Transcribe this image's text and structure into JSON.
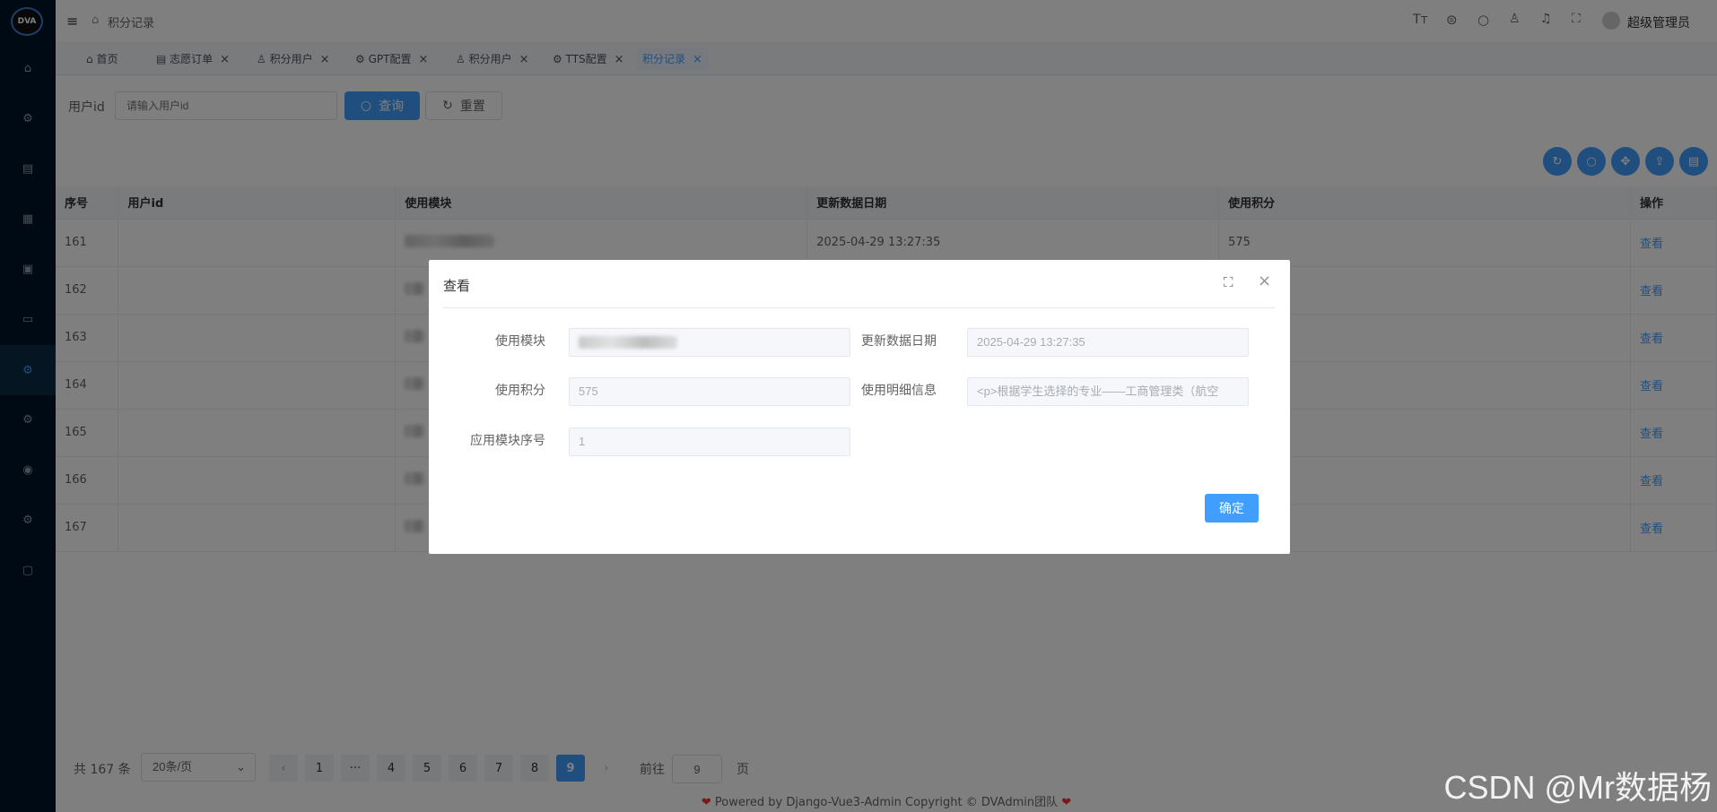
{
  "app": {
    "logo": "DVA",
    "breadcrumb": "积分记录",
    "user_name": "超级管理员"
  },
  "sidebar_icons": [
    "home-icon",
    "settings-icon",
    "document-icon",
    "calendar-icon",
    "report-icon",
    "monitor-icon",
    "gear-icon",
    "gear-icon",
    "user-circle-icon",
    "gear-icon",
    "note-icon"
  ],
  "tabs": [
    {
      "label": "首页",
      "closable": false
    },
    {
      "label": "志愿订单",
      "closable": true
    },
    {
      "label": "积分用户",
      "closable": true
    },
    {
      "label": "GPT配置",
      "closable": true
    },
    {
      "label": "积分用户",
      "closable": true
    },
    {
      "label": "TTS配置",
      "closable": true
    },
    {
      "label": "积分记录",
      "closable": true,
      "active": true
    }
  ],
  "search": {
    "label": "用户id",
    "placeholder": "请输入用户id",
    "query": "查询",
    "reset": "重置"
  },
  "table": {
    "headers": [
      "序号",
      "用户id",
      "使用模块",
      "更新数据日期",
      "使用积分",
      "操作"
    ],
    "rows": [
      {
        "no": "161",
        "date": "2025-04-29 13:27:35",
        "points": "575",
        "action": "查看"
      },
      {
        "no": "162",
        "date": "",
        "points": "",
        "action": "查看"
      },
      {
        "no": "163",
        "date": "",
        "points": "",
        "action": "查看"
      },
      {
        "no": "164",
        "date": "",
        "points": "",
        "action": "查看"
      },
      {
        "no": "165",
        "date": "",
        "points": "",
        "action": "查看"
      },
      {
        "no": "166",
        "date": "",
        "points": "",
        "action": "查看"
      },
      {
        "no": "167",
        "date": "",
        "points": "",
        "action": "查看"
      }
    ]
  },
  "pagination": {
    "total": "共 167 条",
    "page_size": "20条/页",
    "pages": [
      "1",
      "4",
      "5",
      "6",
      "7",
      "8",
      "9"
    ],
    "current": "9",
    "goto_label": "前往",
    "goto_value": "9",
    "goto_suffix": "页"
  },
  "footer": "Powered by Django-Vue3-Admin Copyright © DVAdmin团队",
  "dialog": {
    "title": "查看",
    "fields": {
      "module_label": "使用模块",
      "date_label": "更新数据日期",
      "date_value": "2025-04-29 13:27:35",
      "points_label": "使用积分",
      "points_value": "575",
      "detail_label": "使用明细信息",
      "detail_value": "<p>根据学生选择的专业——工商管理类（航空",
      "index_label": "应用模块序号",
      "index_value": "1"
    },
    "confirm": "确定"
  },
  "watermark": "CSDN @Mr数据杨"
}
